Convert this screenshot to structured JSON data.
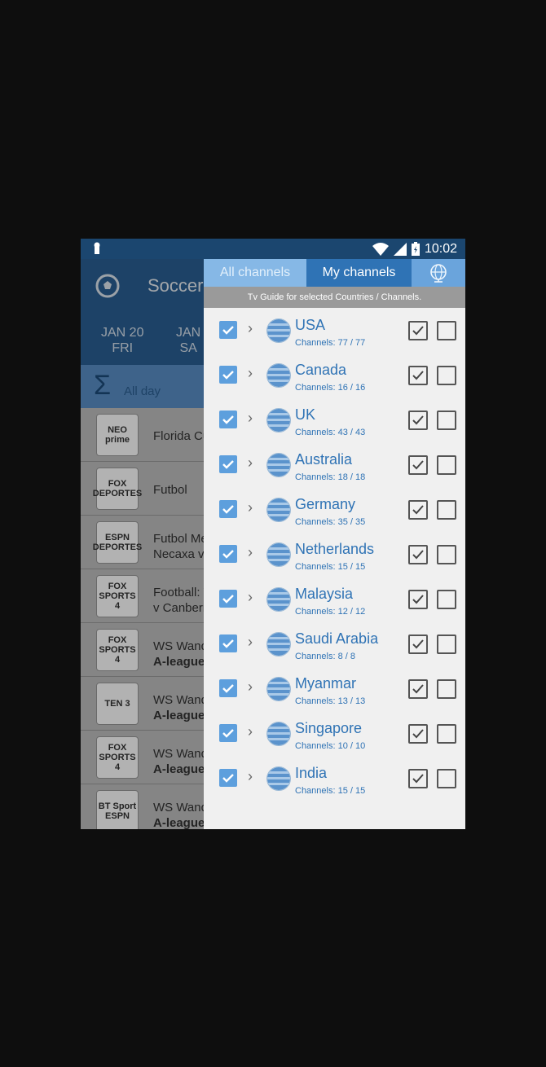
{
  "status_bar": {
    "time": "10:02"
  },
  "app": {
    "title": "Soccer",
    "dates": [
      {
        "month_day": "JAN 20",
        "weekday": "FRI"
      },
      {
        "month_day": "JAN",
        "weekday": "SA"
      }
    ],
    "all_day_label": "All day",
    "rows": [
      {
        "logo": "NEO prime",
        "line1": "Florida Cu",
        "line2": ""
      },
      {
        "logo": "FOX DEPORTES",
        "line1": "Futbol",
        "line2": ""
      },
      {
        "logo": "ESPN DEPORTES",
        "line1": "Futbol Me",
        "line2": "Necaxa vs"
      },
      {
        "logo": "FOX SPORTS 4",
        "line1": "Football: W",
        "line2": "v Canberra"
      },
      {
        "logo": "FOX SPORTS 4",
        "line1": "WS Wande",
        "line2": "A-league"
      },
      {
        "logo": "TEN 3",
        "line1": "WS Wande",
        "line2": "A-league"
      },
      {
        "logo": "FOX SPORTS 4",
        "line1": "WS Wande",
        "line2": "A-league"
      },
      {
        "logo": "BT Sport ESPN",
        "line1": "WS Wande",
        "line2": "A-league"
      }
    ]
  },
  "drawer": {
    "tabs": {
      "all": "All channels",
      "my": "My channels"
    },
    "info": "Tv Guide for selected Countries / Channels.",
    "countries": [
      {
        "name": "USA",
        "count": "Channels: 77 / 77"
      },
      {
        "name": "Canada",
        "count": "Channels: 16 / 16"
      },
      {
        "name": "UK",
        "count": "Channels: 43 / 43"
      },
      {
        "name": "Australia",
        "count": "Channels: 18 / 18"
      },
      {
        "name": "Germany",
        "count": "Channels: 35 / 35"
      },
      {
        "name": "Netherlands",
        "count": "Channels: 15 / 15"
      },
      {
        "name": "Malaysia",
        "count": "Channels: 12 / 12"
      },
      {
        "name": "Saudi Arabia",
        "count": "Channels: 8 / 8"
      },
      {
        "name": "Myanmar",
        "count": "Channels: 13 / 13"
      },
      {
        "name": "Singapore",
        "count": "Channels: 10 / 10"
      },
      {
        "name": "India",
        "count": "Channels: 15 / 15"
      }
    ]
  },
  "colors": {
    "accent": "#2f73b5",
    "header": "#2a5f94",
    "checkbox": "#5d9fdd"
  }
}
